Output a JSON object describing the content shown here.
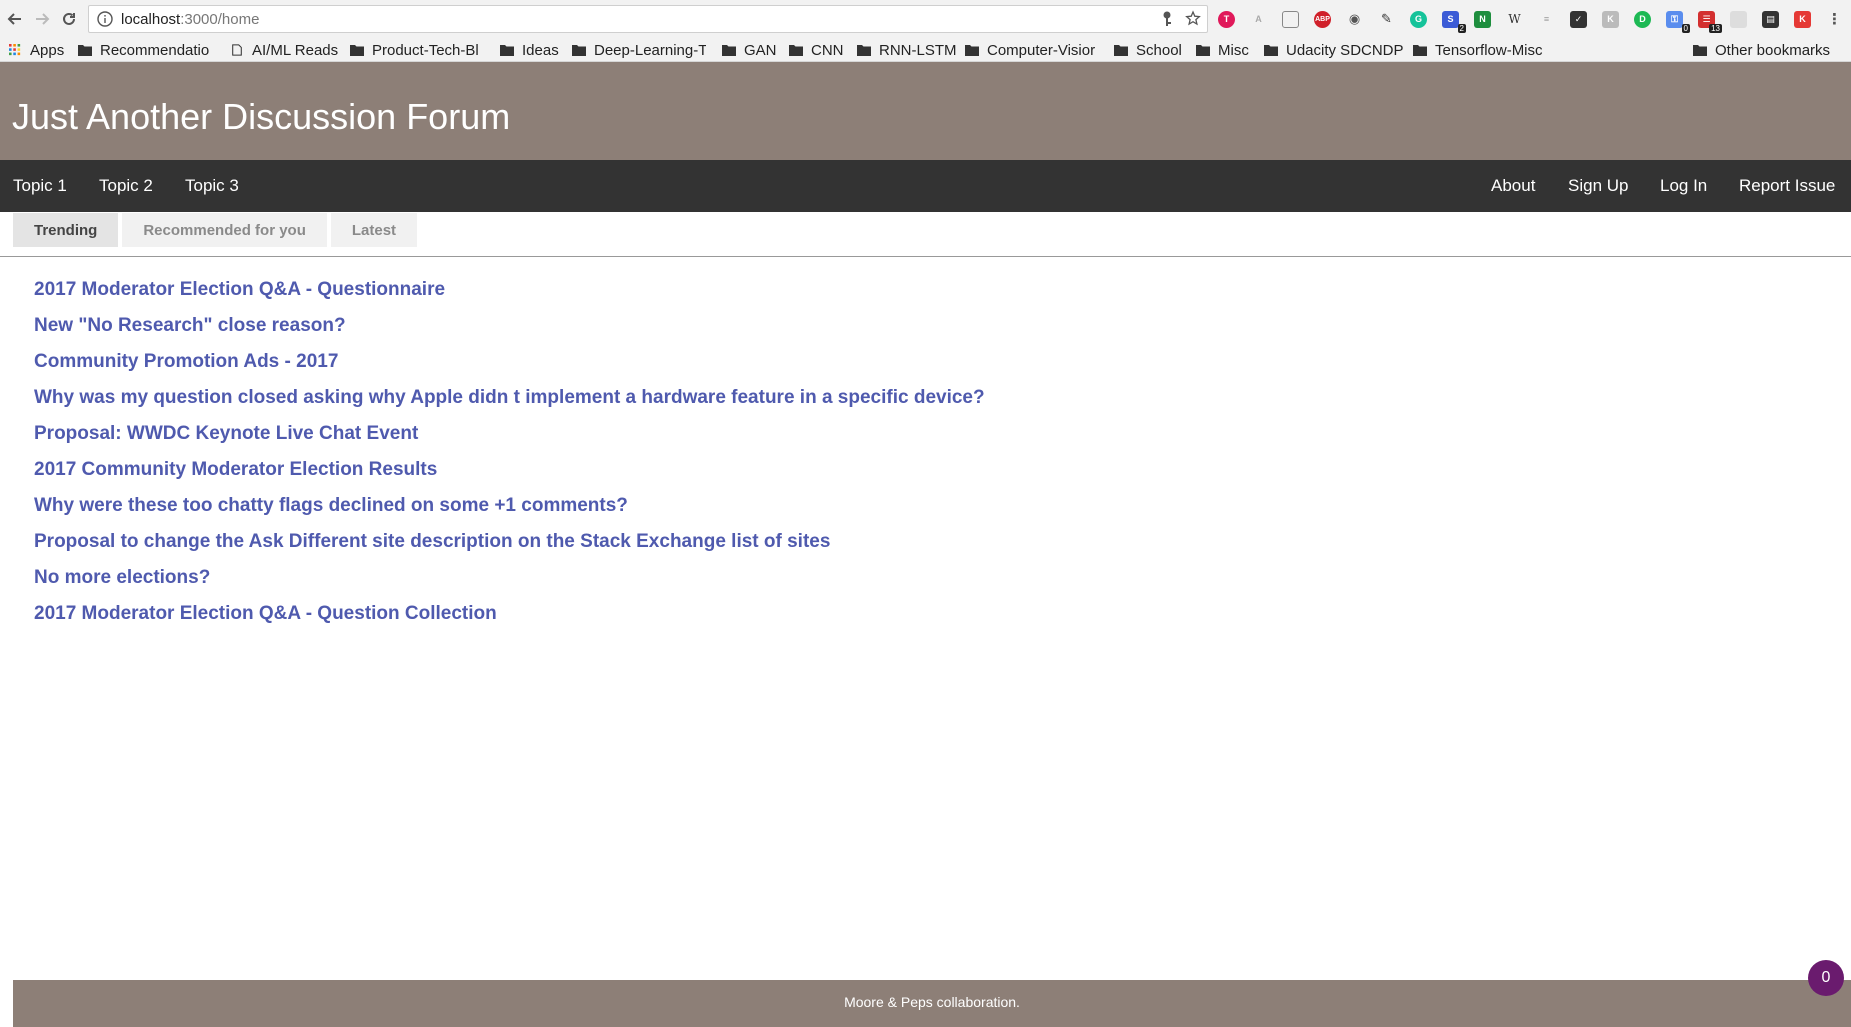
{
  "browser": {
    "url_host": "localhost",
    "url_path": ":3000/home",
    "extension_badges": {
      "ext1": "2",
      "ext2": "0",
      "ext3": "13"
    },
    "bookmarks": [
      {
        "name": "bookmark-apps",
        "label": "Apps",
        "icon": "apps-grid-icon"
      },
      {
        "name": "bookmark-recommendation",
        "label": "Recommendatio",
        "icon": "folder-icon"
      },
      {
        "name": "bookmark-aiml-reads",
        "label": "AI/ML Reads",
        "icon": "page-icon"
      },
      {
        "name": "bookmark-product-tech-blogs",
        "label": "Product-Tech-Bl",
        "icon": "folder-icon"
      },
      {
        "name": "bookmark-ideas",
        "label": "Ideas",
        "icon": "folder-icon"
      },
      {
        "name": "bookmark-deep-learning",
        "label": "Deep-Learning-T",
        "icon": "folder-icon"
      },
      {
        "name": "bookmark-gan",
        "label": "GAN",
        "icon": "folder-icon"
      },
      {
        "name": "bookmark-cnn",
        "label": "CNN",
        "icon": "folder-icon"
      },
      {
        "name": "bookmark-rnn-lstm",
        "label": "RNN-LSTM",
        "icon": "folder-icon"
      },
      {
        "name": "bookmark-computer-vision",
        "label": "Computer-Visior",
        "icon": "folder-icon"
      },
      {
        "name": "bookmark-school",
        "label": "School",
        "icon": "folder-icon"
      },
      {
        "name": "bookmark-misc",
        "label": "Misc",
        "icon": "folder-icon"
      },
      {
        "name": "bookmark-udacity-sdcndp",
        "label": "Udacity SDCNDP",
        "icon": "folder-icon"
      },
      {
        "name": "bookmark-tensorflow-misc",
        "label": "Tensorflow-Misc",
        "icon": "folder-icon"
      }
    ],
    "other_bookmarks": "Other bookmarks"
  },
  "site": {
    "title": "Just Another Discussion Forum",
    "header_color": "#8d7f77",
    "nav_color": "#333333",
    "link_color": "#4f5aae"
  },
  "nav": {
    "left": [
      "Topic 1",
      "Topic 2",
      "Topic 3"
    ],
    "right": [
      "About",
      "Sign Up",
      "Log In",
      "Report Issue"
    ]
  },
  "tabs": [
    {
      "label": "Trending",
      "active": true
    },
    {
      "label": "Recommended for you",
      "active": false
    },
    {
      "label": "Latest",
      "active": false
    }
  ],
  "questions": [
    "2017 Moderator Election Q&A - Questionnaire",
    "New \"No Research\" close reason?",
    "Community Promotion Ads - 2017",
    "Why was my question closed asking why Apple didn t implement a hardware feature in a specific device?",
    "Proposal: WWDC Keynote Live Chat Event",
    "2017 Community Moderator Election Results",
    "Why were these too chatty flags declined on some +1 comments?",
    "Proposal to change the Ask Different site description on the Stack Exchange list of sites",
    "No more elections?",
    "2017 Moderator Election Q&A - Question Collection"
  ],
  "footer": {
    "text": "Moore & Peps collaboration."
  },
  "chat": {
    "count": "0"
  }
}
